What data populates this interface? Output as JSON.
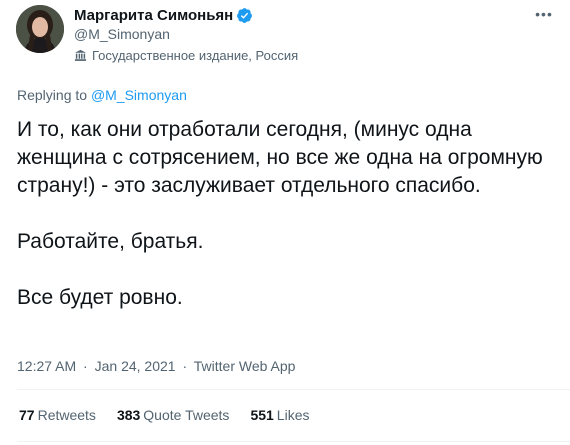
{
  "author": {
    "display_name": "Маргарита Симоньян",
    "handle": "@M_Simonyan",
    "label": "Государственное издание, Россия",
    "avatar_icon": "avatar-photo",
    "verified_icon": "verified-badge-icon",
    "label_icon": "government-building-icon"
  },
  "more_icon": "more-icon",
  "reply": {
    "prefix": "Replying to",
    "mention": "@M_Simonyan"
  },
  "tweet": {
    "paragraphs": [
      "И то, как они отработали сегодня, (минус одна женщина с сотрясением, но все же одна на огромную страну!) - это заслуживает отдельного спасибо.",
      "Работайте, братья.",
      "Все будет ровно."
    ]
  },
  "meta": {
    "time": "12:27 AM",
    "separator": "·",
    "date": "Jan 24, 2021",
    "source": "Twitter Web App"
  },
  "stats": {
    "retweets_count": "77",
    "retweets_label": "Retweets",
    "quotes_count": "383",
    "quotes_label": "Quote Tweets",
    "likes_count": "551",
    "likes_label": "Likes"
  },
  "colors": {
    "link": "#1d9bf0",
    "verified": "#1d9bf0",
    "secondary_text": "#536471",
    "divider": "#eff3f4"
  }
}
